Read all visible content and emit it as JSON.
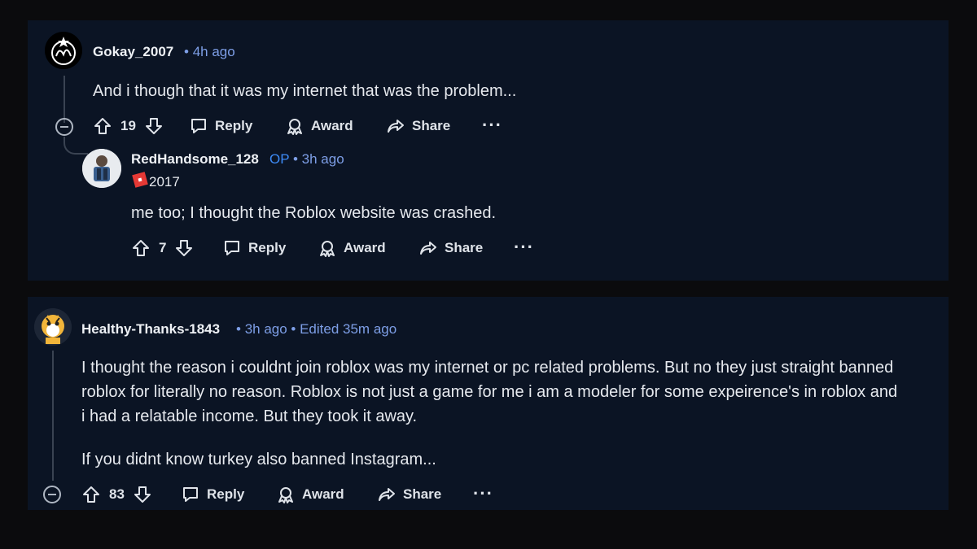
{
  "comments": [
    {
      "user": "Gokay_2007",
      "time": "4h ago",
      "text": "And i though that it was my internet that was the problem...",
      "votes": "19",
      "actions": {
        "reply": "Reply",
        "award": "Award",
        "share": "Share",
        "more": "···"
      }
    },
    {
      "user": "RedHandsome_128",
      "op": "OP",
      "time": "3h ago",
      "flair": "2017",
      "text": "me too; I thought the Roblox website was crashed.",
      "votes": "7",
      "actions": {
        "reply": "Reply",
        "award": "Award",
        "share": "Share",
        "more": "···"
      }
    },
    {
      "user": "Healthy-Thanks-1843",
      "time": "3h ago",
      "edited": "Edited 35m ago",
      "paragraphs": [
        "I thought the reason i couldnt join roblox was my internet or pc related problems. But no they just straight banned",
        "roblox for literally no reason. Roblox is not just a game for me i am a modeler for some expeirence's in roblox and",
        "i had a relatable income. But they took it away.",
        "If you didnt know turkey also banned Instagram..."
      ],
      "votes": "83",
      "actions": {
        "reply": "Reply",
        "award": "Award",
        "share": "Share",
        "more": "···"
      }
    }
  ],
  "colors": {
    "panel": "#0b1424",
    "meta": "#7d9ee6",
    "op": "#3d8bf7",
    "flair": "#e53935"
  }
}
